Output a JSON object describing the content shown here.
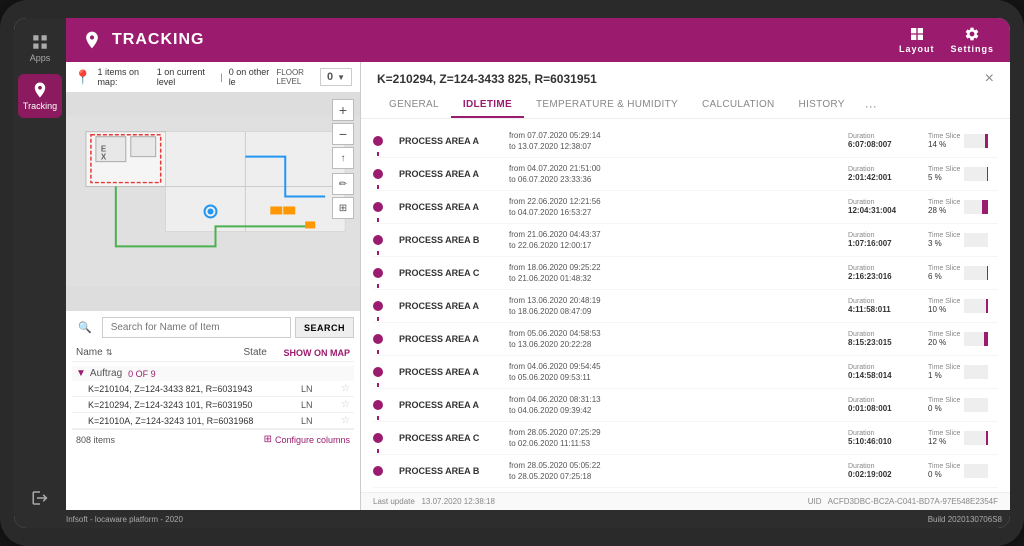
{
  "app": {
    "title": "TRACKING"
  },
  "sidebar": {
    "items": [
      {
        "label": "Apps",
        "icon": "grid"
      },
      {
        "label": "Tracking",
        "icon": "location",
        "active": true
      }
    ],
    "logout_label": "logout"
  },
  "topbar": {
    "title": "TRACKING",
    "layout_label": "Layout",
    "settings_label": "Settings"
  },
  "map": {
    "items_text": "1 items on map:",
    "current_level": "1 on current level",
    "other_level": "0 on other le",
    "floor_label": "FLOOR LEVEL",
    "floor_value": "0",
    "search_placeholder": "Search for Name of Item",
    "search_button": "SEARCH",
    "show_on_map": "SHOW ON MAP",
    "name_col": "Name",
    "state_col": "State",
    "group": {
      "label": "Auftrag",
      "count": "0 OF 9"
    },
    "items": [
      {
        "name": "K=210104, Z=124-3433 821, R=6031943",
        "state": "LN"
      },
      {
        "name": "K=210294, Z=124-3243 101, R=6031950",
        "state": "LN"
      },
      {
        "name": "K=21010A, Z=124-3243 101, R=6031968",
        "state": "LN"
      }
    ],
    "total_items": "808 items",
    "configure_columns": "Configure columns"
  },
  "detail": {
    "title": "K=210294, Z=124-3433 825, R=6031951",
    "tabs": [
      "GENERAL",
      "IDLETIME",
      "TEMPERATURE & HUMIDITY",
      "CALCULATION",
      "HISTORY"
    ],
    "active_tab": "IDLETIME",
    "timeline_items": [
      {
        "area": "PROCESS AREA A",
        "from": "from 07.07.2020 05:29:14",
        "to": "to 13.07.2020 12:38:07",
        "duration_label": "Duration",
        "duration": "6:07:08:007",
        "timeslice_label": "Time Slice",
        "timeslice": "14 %",
        "timeslice_val": 14
      },
      {
        "area": "PROCESS AREA A",
        "from": "from 04.07.2020 21:51:00",
        "to": "to 06.07.2020 23:33:36",
        "duration_label": "Duration",
        "duration": "2:01:42:001",
        "timeslice_label": "Time Slice",
        "timeslice": "5 %",
        "timeslice_val": 5
      },
      {
        "area": "PROCESS AREA A",
        "from": "from 22.06.2020 12:21:56",
        "to": "to 04.07.2020 16:53:27",
        "duration_label": "Duration",
        "duration": "12:04:31:004",
        "timeslice_label": "Time Slice",
        "timeslice": "28 %",
        "timeslice_val": 28
      },
      {
        "area": "PROCESS AREA B",
        "from": "from 21.06.2020 04:43:37",
        "to": "to 22.06.2020 12:00:17",
        "duration_label": "Duration",
        "duration": "1:07:16:007",
        "timeslice_label": "Time Slice",
        "timeslice": "3 %",
        "timeslice_val": 3
      },
      {
        "area": "PROCESS AREA C",
        "from": "from 18.06.2020 09:25:22",
        "to": "to 21.06.2020 01:48:32",
        "duration_label": "Duration",
        "duration": "2:16:23:016",
        "timeslice_label": "Time Slice",
        "timeslice": "6 %",
        "timeslice_val": 6
      },
      {
        "area": "PROCESS AREA A",
        "from": "from 13.06.2020 20:48:19",
        "to": "to 18.06.2020 08:47:09",
        "duration_label": "Duration",
        "duration": "4:11:58:011",
        "timeslice_label": "Time Slice",
        "timeslice": "10 %",
        "timeslice_val": 10
      },
      {
        "area": "PROCESS AREA A",
        "from": "from 05.06.2020 04:58:53",
        "to": "to 13.06.2020 20:22:28",
        "duration_label": "Duration",
        "duration": "8:15:23:015",
        "timeslice_label": "Time Slice",
        "timeslice": "20 %",
        "timeslice_val": 20
      },
      {
        "area": "PROCESS AREA A",
        "from": "from 04.06.2020 09:54:45",
        "to": "to 05.06.2020 09:53:11",
        "duration_label": "Duration",
        "duration": "0:14:58:014",
        "timeslice_label": "Time Slice",
        "timeslice": "1 %",
        "timeslice_val": 1
      },
      {
        "area": "PROCESS AREA A",
        "from": "from 04.06.2020 08:31:13",
        "to": "to 04.06.2020 09:39:42",
        "duration_label": "Duration",
        "duration": "0:01:08:001",
        "timeslice_label": "Time Slice",
        "timeslice": "0 %",
        "timeslice_val": 0
      },
      {
        "area": "PROCESS AREA C",
        "from": "from 28.05.2020 07:25:29",
        "to": "to 02.06.2020 11:11:53",
        "duration_label": "Duration",
        "duration": "5:10:46:010",
        "timeslice_label": "Time Slice",
        "timeslice": "12 %",
        "timeslice_val": 12
      },
      {
        "area": "PROCESS AREA B",
        "from": "from 28.05.2020 05:05:22",
        "to": "to 28.05.2020 07:25:18",
        "duration_label": "Duration",
        "duration": "0:02:19:002",
        "timeslice_label": "Time Slice",
        "timeslice": "0 %",
        "timeslice_val": 0
      }
    ],
    "footer": {
      "last_update_label": "Last update",
      "last_update_value": "13.07.2020 12:38:18",
      "uid_label": "UID",
      "uid_value": "ACFD3DBC-BC2A-C041-BD7A-97E548E2354F"
    }
  },
  "footer": {
    "brand": "Infsoft - locaware platform - 2020",
    "build": "Build 2020130706S8"
  }
}
